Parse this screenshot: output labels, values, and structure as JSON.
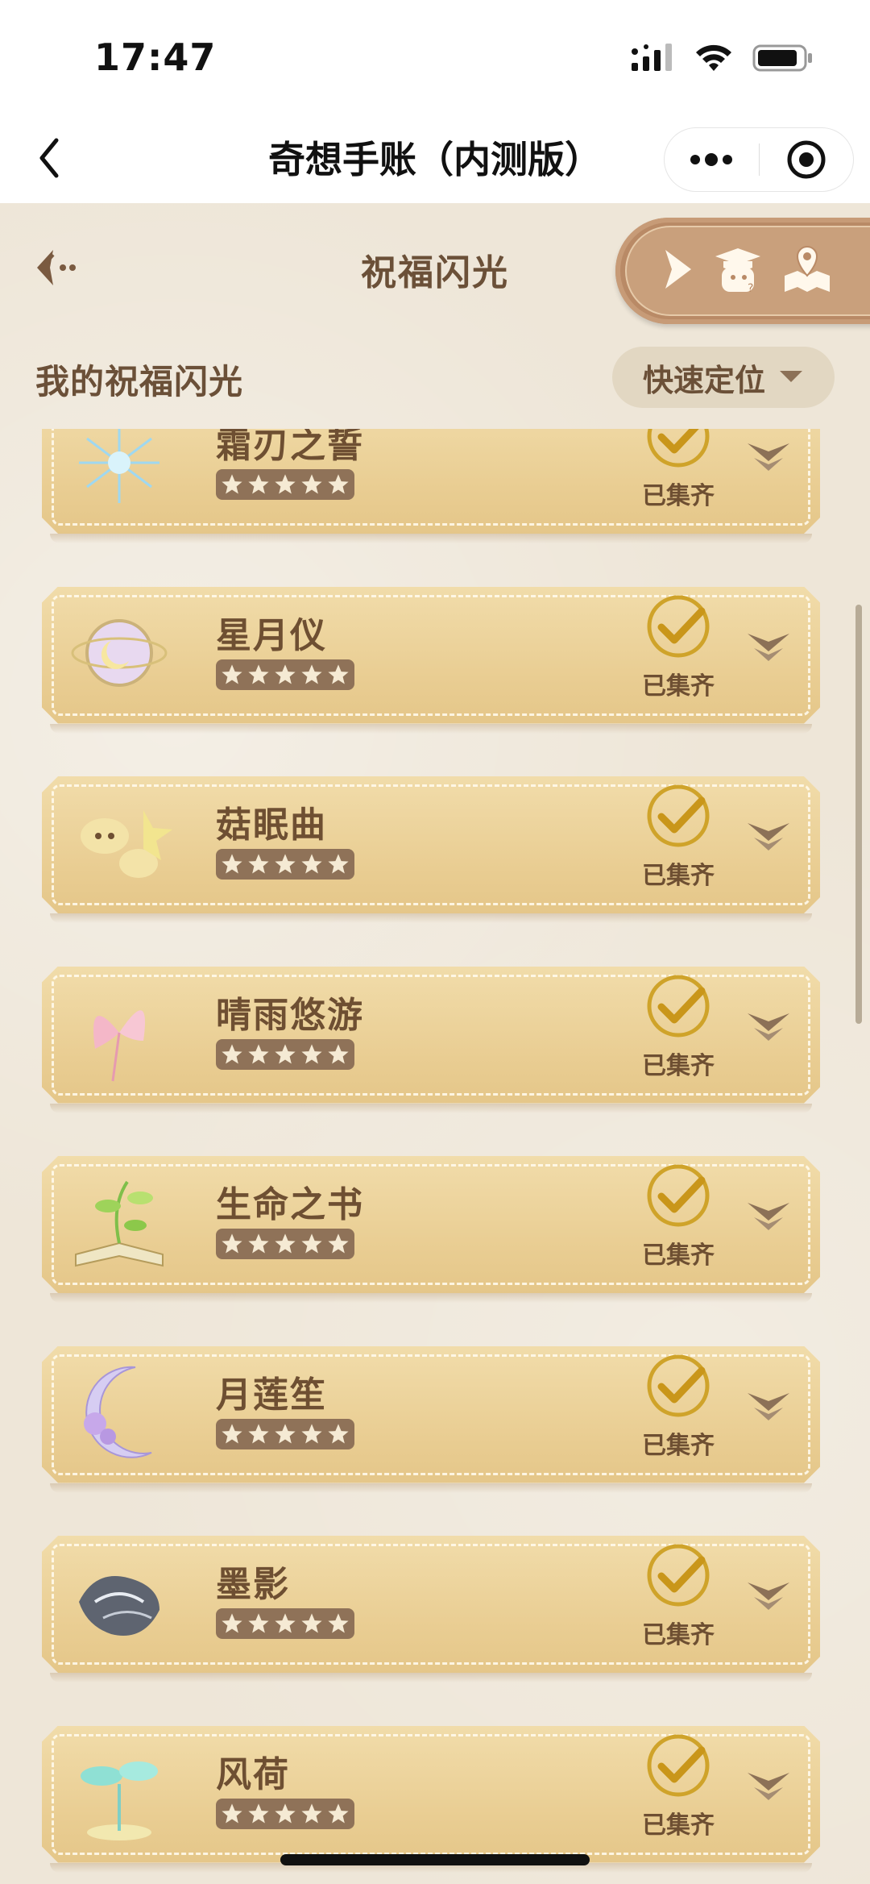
{
  "status": {
    "time": "17:47"
  },
  "nav": {
    "title": "奇想手账（内测版）"
  },
  "header": {
    "title": "祝福闪光"
  },
  "section": {
    "title": "我的祝福闪光",
    "quick_locate": "快速定位"
  },
  "colors": {
    "card": "#e9cd92",
    "text": "#6e4f32",
    "check": "#c9961a",
    "pill": "#b98a66"
  },
  "items": [
    {
      "name": "霜刃之誓",
      "status": "已集齐",
      "stars": 5,
      "art": "ice-spikes"
    },
    {
      "name": "星月仪",
      "status": "已集齐",
      "stars": 5,
      "art": "star-moon-orb"
    },
    {
      "name": "菇眠曲",
      "status": "已集齐",
      "stars": 5,
      "art": "mushroom"
    },
    {
      "name": "晴雨悠游",
      "status": "已集齐",
      "stars": 5,
      "art": "pink-wings"
    },
    {
      "name": "生命之书",
      "status": "已集齐",
      "stars": 5,
      "art": "green-book"
    },
    {
      "name": "月莲笙",
      "status": "已集齐",
      "stars": 5,
      "art": "lotus-moon"
    },
    {
      "name": "墨影",
      "status": "已集齐",
      "stars": 5,
      "art": "ink-shadow"
    },
    {
      "name": "风荷",
      "status": "已集齐",
      "stars": 5,
      "art": "teal-lotus"
    }
  ]
}
